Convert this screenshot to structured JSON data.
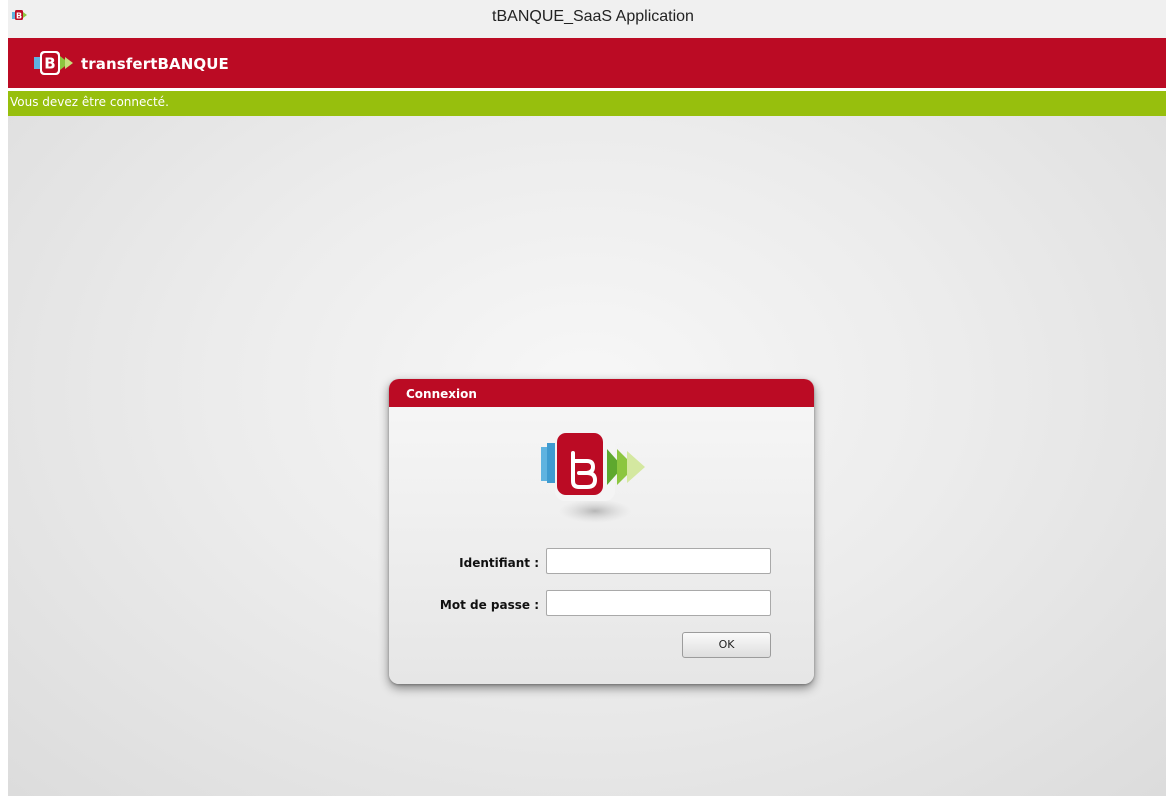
{
  "window": {
    "title": "tBANQUE_SaaS Application"
  },
  "brand": {
    "name": "transfertBANQUE",
    "colors": {
      "primary": "#bb0b24",
      "status": "#97bf0d",
      "accent_blue": "#5fb3e0",
      "accent_green": "#8cc63f"
    },
    "logo_icon": "transfertbanque-logo-icon"
  },
  "status": {
    "message": "Vous devez être connecté."
  },
  "login": {
    "title": "Connexion",
    "username_label": "Identifiant :",
    "username_value": "",
    "password_label": "Mot de passe :",
    "password_value": "",
    "submit_label": "OK"
  }
}
